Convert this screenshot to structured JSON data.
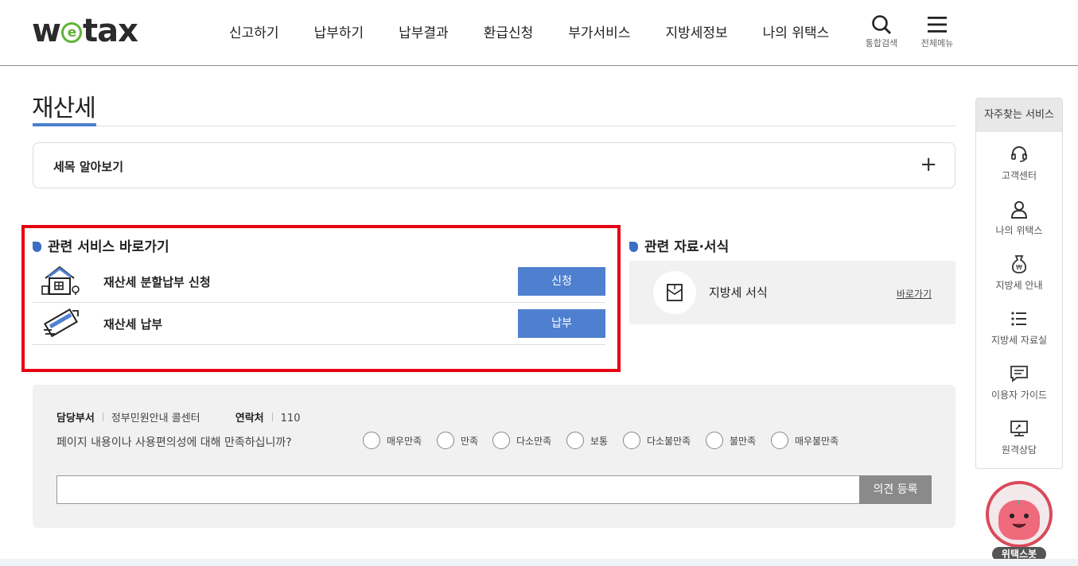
{
  "header": {
    "logo": {
      "pre": "w",
      "mid": "e",
      "post": "tax"
    },
    "nav": [
      "신고하기",
      "납부하기",
      "납부결과",
      "환급신청",
      "부가서비스",
      "지방세정보",
      "나의 위택스"
    ],
    "search_label": "통합검색",
    "menu_label": "전체메뉴"
  },
  "page": {
    "title": "재산세",
    "accordion_label": "세목 알아보기"
  },
  "related_services": {
    "title": "관련 서비스 바로가기",
    "items": [
      {
        "name": "재산세 분할납부 신청",
        "button": "신청",
        "icon": "house-icon"
      },
      {
        "name": "재산세 납부",
        "button": "납부",
        "icon": "payment-card-icon"
      }
    ]
  },
  "related_forms": {
    "title": "관련 자료·서식",
    "item_name": "지방세 서식",
    "link": "바로가기",
    "icon": "document-envelope-icon"
  },
  "feedback": {
    "dept_label": "담당부서",
    "dept_value": "정부민원안내 콜센터",
    "contact_label": "연락처",
    "contact_value": "110",
    "question": "페이지 내용이나 사용편의성에 대해 만족하십니까?",
    "options": [
      "매우만족",
      "만족",
      "다소만족",
      "보통",
      "다소불만족",
      "불만족",
      "매우불만족"
    ],
    "submit": "의견 등록"
  },
  "quick_menu": {
    "title": "자주찾는 서비스",
    "items": [
      {
        "label": "고객센터",
        "icon": "headset-icon"
      },
      {
        "label": "나의 위택스",
        "icon": "person-icon"
      },
      {
        "label": "지방세 안내",
        "icon": "money-bag-icon"
      },
      {
        "label": "지방세 자료실",
        "icon": "list-icon"
      },
      {
        "label": "이용자 가이드",
        "icon": "chat-icon"
      },
      {
        "label": "원격상담",
        "icon": "monitor-icon"
      }
    ]
  },
  "chatbot": {
    "label": "위택스봇"
  },
  "colors": {
    "accent": "#4f80d0",
    "highlight_border": "#e60012",
    "logo_green": "#5fb336"
  }
}
